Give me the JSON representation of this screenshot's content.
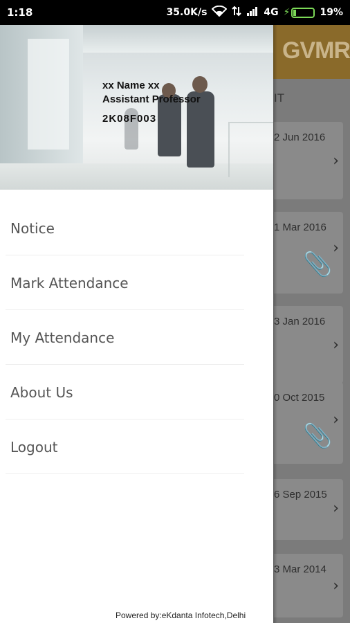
{
  "status_bar": {
    "time": "1:18",
    "network_speed": "35.0K/s",
    "network_type": "4G",
    "battery": "19%",
    "icons": [
      "wifi-icon",
      "data-arrows-icon",
      "signal-icon",
      "charging-bolt-icon",
      "battery-icon"
    ]
  },
  "drawer": {
    "user": {
      "name": "xx Name xx",
      "role": "Assistant Professor",
      "id": "2K08F003"
    },
    "menu": [
      {
        "label": "Notice"
      },
      {
        "label": "Mark Attendance"
      },
      {
        "label": "My Attendance"
      },
      {
        "label": "About Us"
      },
      {
        "label": "Logout"
      }
    ],
    "footer": "Powered by:eKdanta Infotech,Delhi"
  },
  "background_app": {
    "logo": "GVMR",
    "tab_fragment": "IT",
    "cards": [
      {
        "date": "2 Jun 2016",
        "attachment": false
      },
      {
        "date": "1 Mar 2016",
        "attachment": true
      },
      {
        "date": "3 Jan 2016",
        "attachment": false
      },
      {
        "date": "0 Oct 2015",
        "attachment": true
      },
      {
        "date": "6 Sep 2015",
        "attachment": false
      },
      {
        "date": "3 Mar 2014",
        "attachment": false
      }
    ],
    "colors": {
      "header": "#8a6a2a",
      "scrim": "#7b7b7b"
    }
  }
}
